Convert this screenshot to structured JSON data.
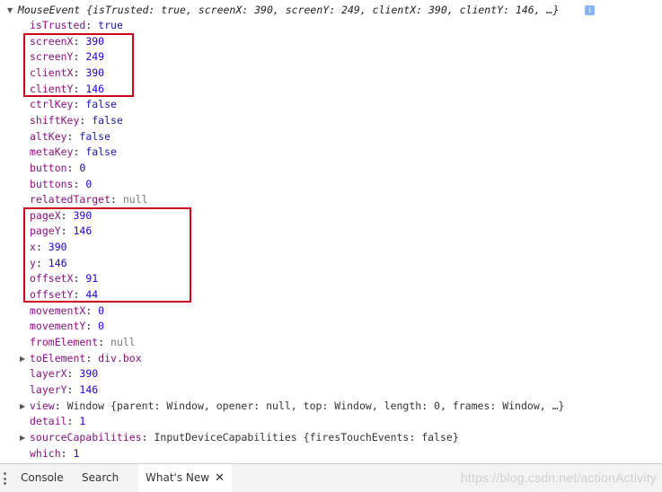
{
  "header": {
    "class_name": "MouseEvent",
    "preview": "{isTrusted: true, screenX: 390, screenY: 249, clientX: 390, clientY: 146, …}",
    "info_badge": "i"
  },
  "props": [
    {
      "key": "isTrusted",
      "value": "true",
      "kind": "bool"
    },
    {
      "key": "screenX",
      "value": "390",
      "kind": "num"
    },
    {
      "key": "screenY",
      "value": "249",
      "kind": "num"
    },
    {
      "key": "clientX",
      "value": "390",
      "kind": "num"
    },
    {
      "key": "clientY",
      "value": "146",
      "kind": "num"
    },
    {
      "key": "ctrlKey",
      "value": "false",
      "kind": "bool"
    },
    {
      "key": "shiftKey",
      "value": "false",
      "kind": "bool"
    },
    {
      "key": "altKey",
      "value": "false",
      "kind": "bool"
    },
    {
      "key": "metaKey",
      "value": "false",
      "kind": "bool"
    },
    {
      "key": "button",
      "value": "0",
      "kind": "num"
    },
    {
      "key": "buttons",
      "value": "0",
      "kind": "num"
    },
    {
      "key": "relatedTarget",
      "value": "null",
      "kind": "null"
    },
    {
      "key": "pageX",
      "value": "390",
      "kind": "num"
    },
    {
      "key": "pageY",
      "value": "146",
      "kind": "num"
    },
    {
      "key": "x",
      "value": "390",
      "kind": "num"
    },
    {
      "key": "y",
      "value": "146",
      "kind": "num"
    },
    {
      "key": "offsetX",
      "value": "91",
      "kind": "num"
    },
    {
      "key": "offsetY",
      "value": "44",
      "kind": "num"
    },
    {
      "key": "movementX",
      "value": "0",
      "kind": "num"
    },
    {
      "key": "movementY",
      "value": "0",
      "kind": "num"
    },
    {
      "key": "fromElement",
      "value": "null",
      "kind": "null"
    },
    {
      "key": "toElement",
      "value": "div.box",
      "kind": "node",
      "expandable": true
    },
    {
      "key": "layerX",
      "value": "390",
      "kind": "num"
    },
    {
      "key": "layerY",
      "value": "146",
      "kind": "num"
    },
    {
      "key": "view",
      "value": "Window {parent: Window, opener: null, top: Window, length: 0, frames: Window, …}",
      "kind": "cls",
      "expandable": true
    },
    {
      "key": "detail",
      "value": "1",
      "kind": "num"
    },
    {
      "key": "sourceCapabilities",
      "value": "InputDeviceCapabilities {firesTouchEvents: false}",
      "kind": "cls",
      "expandable": true
    },
    {
      "key": "which",
      "value": "1",
      "kind": "num"
    }
  ],
  "drawer": {
    "tabs": [
      "Console",
      "Search",
      "What's New"
    ],
    "active_tab": "What's New",
    "close_glyph": "✕"
  },
  "watermark": "https://blog.csdn.net/actionActivity",
  "colors": {
    "highlight_box": "#d0021b",
    "key": "#881280",
    "number": "#1c00cf",
    "boolean": "#1a1aa6"
  }
}
